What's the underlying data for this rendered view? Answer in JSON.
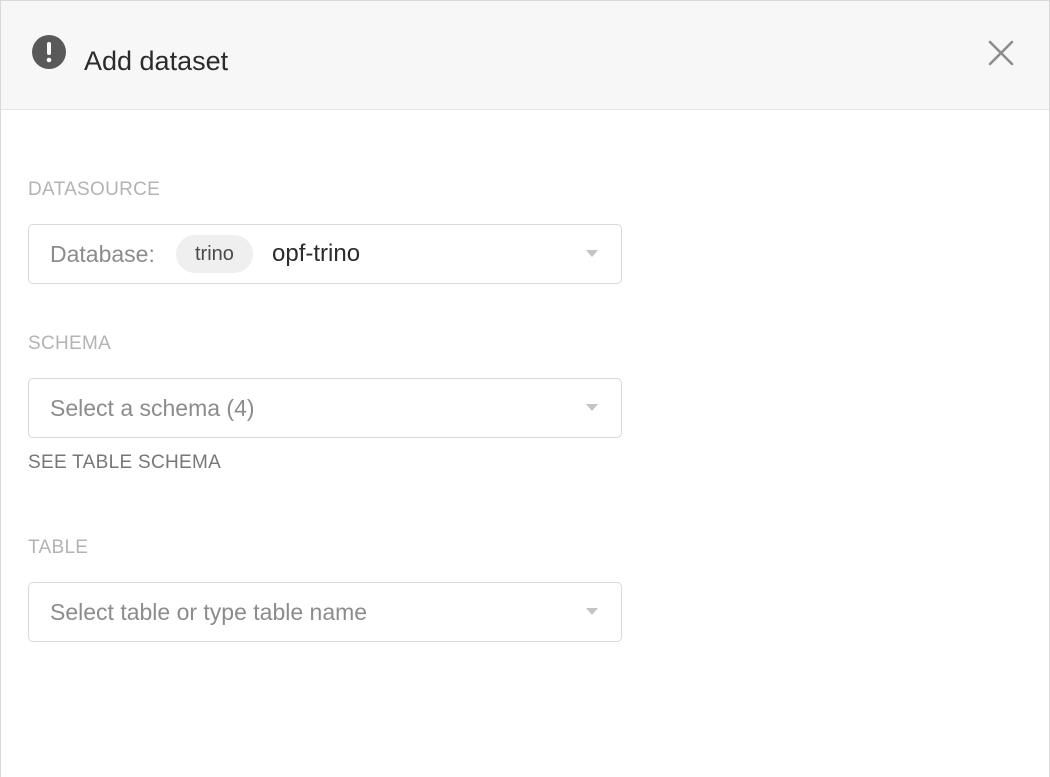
{
  "header": {
    "title": "Add dataset",
    "warning_icon": "exclamation-circle-icon",
    "close_icon": "close-x-icon"
  },
  "datasource": {
    "label": "DATASOURCE",
    "prefix": "Database:",
    "tag": "trino",
    "value": "opf-trino"
  },
  "schema": {
    "label": "SCHEMA",
    "placeholder": "Select a schema (4)",
    "see_link": "SEE TABLE SCHEMA"
  },
  "table": {
    "label": "TABLE",
    "placeholder": "Select table or type table name"
  },
  "colors": {
    "header_bg": "#f7f7f7",
    "label": "#b3b3b3",
    "border": "#d9d9d9",
    "tag_bg": "#efefef"
  }
}
